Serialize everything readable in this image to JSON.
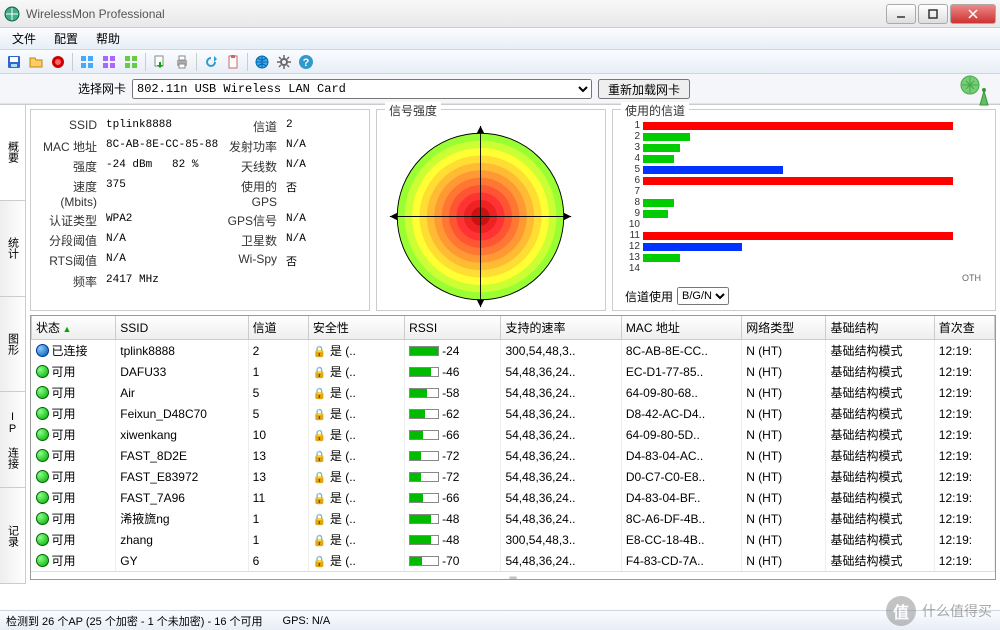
{
  "window": {
    "title": "WirelessMon Professional"
  },
  "menu": {
    "file": "文件",
    "config": "配置",
    "help": "帮助"
  },
  "nic": {
    "label": "选择网卡",
    "selected": "802.11n USB Wireless LAN Card",
    "reload": "重新加载网卡"
  },
  "sidetabs": [
    "概要",
    "统计",
    "图形",
    "IP 连接",
    "记录"
  ],
  "details": {
    "ssid_lbl": "SSID",
    "ssid": "tplink8888",
    "mac_lbl": "MAC 地址",
    "mac": "8C-AB-8E-CC-85-88",
    "strength_lbl": "强度",
    "strength": "-24 dBm",
    "strength_pct": "82 %",
    "speed_lbl": "速度(Mbits)",
    "speed": "375",
    "auth_lbl": "认证类型",
    "auth": "WPA2",
    "frag_lbl": "分段阈值",
    "frag": "N/A",
    "rts_lbl": "RTS阈值",
    "rts": "N/A",
    "freq_lbl": "频率",
    "freq": "2417 MHz",
    "chan_lbl": "信道",
    "chan": "2",
    "txpow_lbl": "发射功率",
    "txpow": "N/A",
    "ant_lbl": "天线数",
    "ant": "N/A",
    "gps_lbl": "使用的GPS",
    "gps": "否",
    "gpssig_lbl": "GPS信号",
    "gpssig": "N/A",
    "sat_lbl": "卫星数",
    "sat": "N/A",
    "wispy_lbl": "Wi-Spy",
    "wispy": "否"
  },
  "panels": {
    "signal": "信号强度",
    "channels": "使用的信道",
    "chuse_lbl": "信道使用",
    "chuse_val": "B/G/N",
    "oth": "OTH"
  },
  "chart_data": {
    "type": "bar",
    "title": "使用的信道",
    "xlabel": "信道",
    "ylabel": "",
    "categories": [
      1,
      2,
      3,
      4,
      5,
      6,
      7,
      8,
      9,
      10,
      11,
      12,
      13,
      14
    ],
    "series": [
      {
        "name": "B",
        "color": "#ff0000",
        "values": [
          100,
          0,
          0,
          0,
          0,
          100,
          0,
          0,
          0,
          0,
          100,
          0,
          0,
          0
        ]
      },
      {
        "name": "G",
        "color": "#00cc00",
        "values": [
          0,
          15,
          12,
          10,
          0,
          0,
          0,
          10,
          8,
          0,
          0,
          0,
          12,
          0
        ]
      },
      {
        "name": "N",
        "color": "#0033ff",
        "values": [
          0,
          0,
          0,
          0,
          45,
          0,
          0,
          0,
          0,
          0,
          0,
          32,
          0,
          0
        ]
      }
    ]
  },
  "columns": {
    "status": "状态",
    "ssid": "SSID",
    "chan": "信道",
    "sec": "安全性",
    "rssi": "RSSI",
    "rates": "支持的速率",
    "mac": "MAC 地址",
    "ntype": "网络类型",
    "infra": "基础结构",
    "first": "首次查"
  },
  "sec_yes": "是 (..",
  "aps": [
    {
      "st": "已连接",
      "dot": "blue",
      "ssid": "tplink8888",
      "ch": "2",
      "rssi": -24,
      "rates": "300,54,48,3..",
      "mac": "8C-AB-8E-CC..",
      "nt": "N (HT)",
      "infra": "基础结构模式",
      "first": "12:19:"
    },
    {
      "st": "可用",
      "dot": "green",
      "ssid": "DAFU33",
      "ch": "1",
      "rssi": -46,
      "rates": "54,48,36,24..",
      "mac": "EC-D1-77-85..",
      "nt": "N (HT)",
      "infra": "基础结构模式",
      "first": "12:19:"
    },
    {
      "st": "可用",
      "dot": "green",
      "ssid": "Air",
      "ch": "5",
      "rssi": -58,
      "rates": "54,48,36,24..",
      "mac": "64-09-80-68..",
      "nt": "N (HT)",
      "infra": "基础结构模式",
      "first": "12:19:"
    },
    {
      "st": "可用",
      "dot": "green",
      "ssid": "Feixun_D48C70",
      "ch": "5",
      "rssi": -62,
      "rates": "54,48,36,24..",
      "mac": "D8-42-AC-D4..",
      "nt": "N (HT)",
      "infra": "基础结构模式",
      "first": "12:19:"
    },
    {
      "st": "可用",
      "dot": "green",
      "ssid": "xiwenkang",
      "ch": "10",
      "rssi": -66,
      "rates": "54,48,36,24..",
      "mac": "64-09-80-5D..",
      "nt": "N (HT)",
      "infra": "基础结构模式",
      "first": "12:19:"
    },
    {
      "st": "可用",
      "dot": "green",
      "ssid": "FAST_8D2E",
      "ch": "13",
      "rssi": -72,
      "rates": "54,48,36,24..",
      "mac": "D4-83-04-AC..",
      "nt": "N (HT)",
      "infra": "基础结构模式",
      "first": "12:19:"
    },
    {
      "st": "可用",
      "dot": "green",
      "ssid": "FAST_E83972",
      "ch": "13",
      "rssi": -72,
      "rates": "54,48,36,24..",
      "mac": "D0-C7-C0-E8..",
      "nt": "N (HT)",
      "infra": "基础结构模式",
      "first": "12:19:"
    },
    {
      "st": "可用",
      "dot": "green",
      "ssid": "FAST_7A96",
      "ch": "11",
      "rssi": -66,
      "rates": "54,48,36,24..",
      "mac": "D4-83-04-BF..",
      "nt": "N (HT)",
      "infra": "基础结构模式",
      "first": "12:19:"
    },
    {
      "st": "可用",
      "dot": "green",
      "ssid": "浠掖旒ng",
      "ch": "1",
      "rssi": -48,
      "rates": "54,48,36,24..",
      "mac": "8C-A6-DF-4B..",
      "nt": "N (HT)",
      "infra": "基础结构模式",
      "first": "12:19:"
    },
    {
      "st": "可用",
      "dot": "green",
      "ssid": "zhang",
      "ch": "1",
      "rssi": -48,
      "rates": "300,54,48,3..",
      "mac": "E8-CC-18-4B..",
      "nt": "N (HT)",
      "infra": "基础结构模式",
      "first": "12:19:"
    },
    {
      "st": "可用",
      "dot": "green",
      "ssid": "GY",
      "ch": "6",
      "rssi": -70,
      "rates": "54,48,36,24..",
      "mac": "F4-83-CD-7A..",
      "nt": "N (HT)",
      "infra": "基础结构模式",
      "first": "12:19:"
    }
  ],
  "status": {
    "detected": "检测到 26 个AP (25 个加密 - 1 个未加密) - 16 个可用",
    "gps": "GPS: N/A"
  },
  "watermark": "什么值得买"
}
